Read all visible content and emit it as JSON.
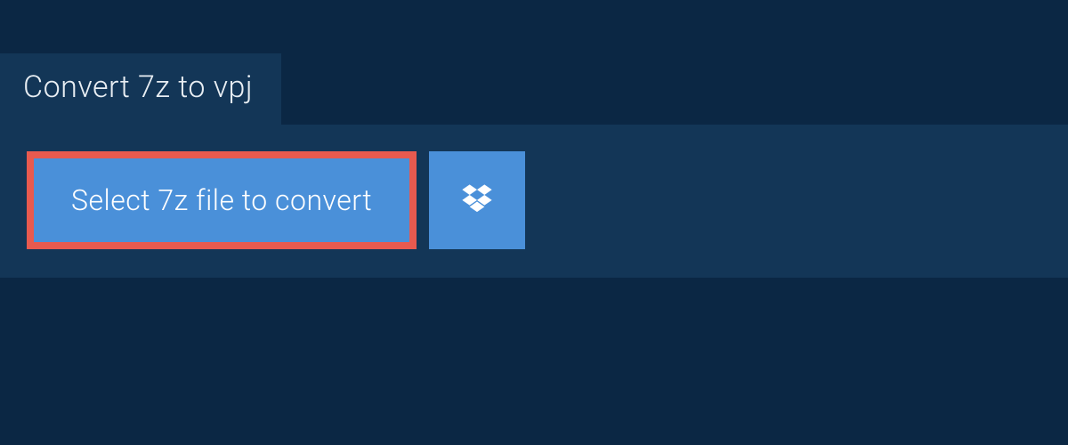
{
  "tab": {
    "title": "Convert 7z to vpj"
  },
  "actions": {
    "select_file_label": "Select 7z file to convert",
    "dropbox_icon": "dropbox"
  },
  "colors": {
    "page_bg": "#0b2744",
    "panel_bg": "#133657",
    "button_bg": "#4a90d9",
    "highlight_border": "#e85a4f",
    "text_light": "#ffffff"
  }
}
